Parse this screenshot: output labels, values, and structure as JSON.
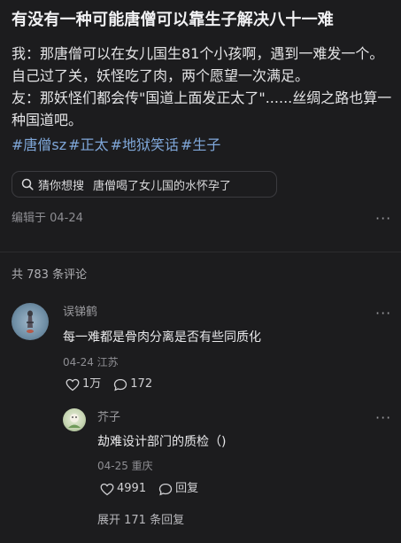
{
  "post": {
    "title": "有没有一种可能唐僧可以靠生子解决八十一难",
    "lines": [
      "我：那唐僧可以在女儿国生81个小孩啊，遇到一难发一个。自己过了关，妖怪吃了肉，两个愿望一次满足。",
      "友：那妖怪们都会传\"国道上面发正太了\"......丝绸之路也算一种国道吧。"
    ],
    "tags": [
      "#唐僧sz",
      "#正太",
      "#地狱笑话",
      "#生子"
    ],
    "search_chip": {
      "hint": "猜你想搜",
      "query": "唐僧喝了女儿国的水怀孕了"
    },
    "edited": "编辑于 04-24",
    "more": "···"
  },
  "comments_header": "共 783 条评论",
  "comments": [
    {
      "user": "误锑鹤",
      "text": "每一难都是骨肉分离是否有些同质化",
      "meta": "04-24 江苏",
      "likes": "1万",
      "replies": "172"
    }
  ],
  "reply": {
    "user": "芥子",
    "text": "劫难设计部门的质检（)",
    "meta": "04-25 重庆",
    "likes": "4991",
    "reply_label": "回复"
  },
  "expand_label": "展开 171 条回复",
  "colors": {
    "background": "#1c1c1e",
    "tag": "#7fa7d9",
    "muted": "#8e8e93"
  }
}
